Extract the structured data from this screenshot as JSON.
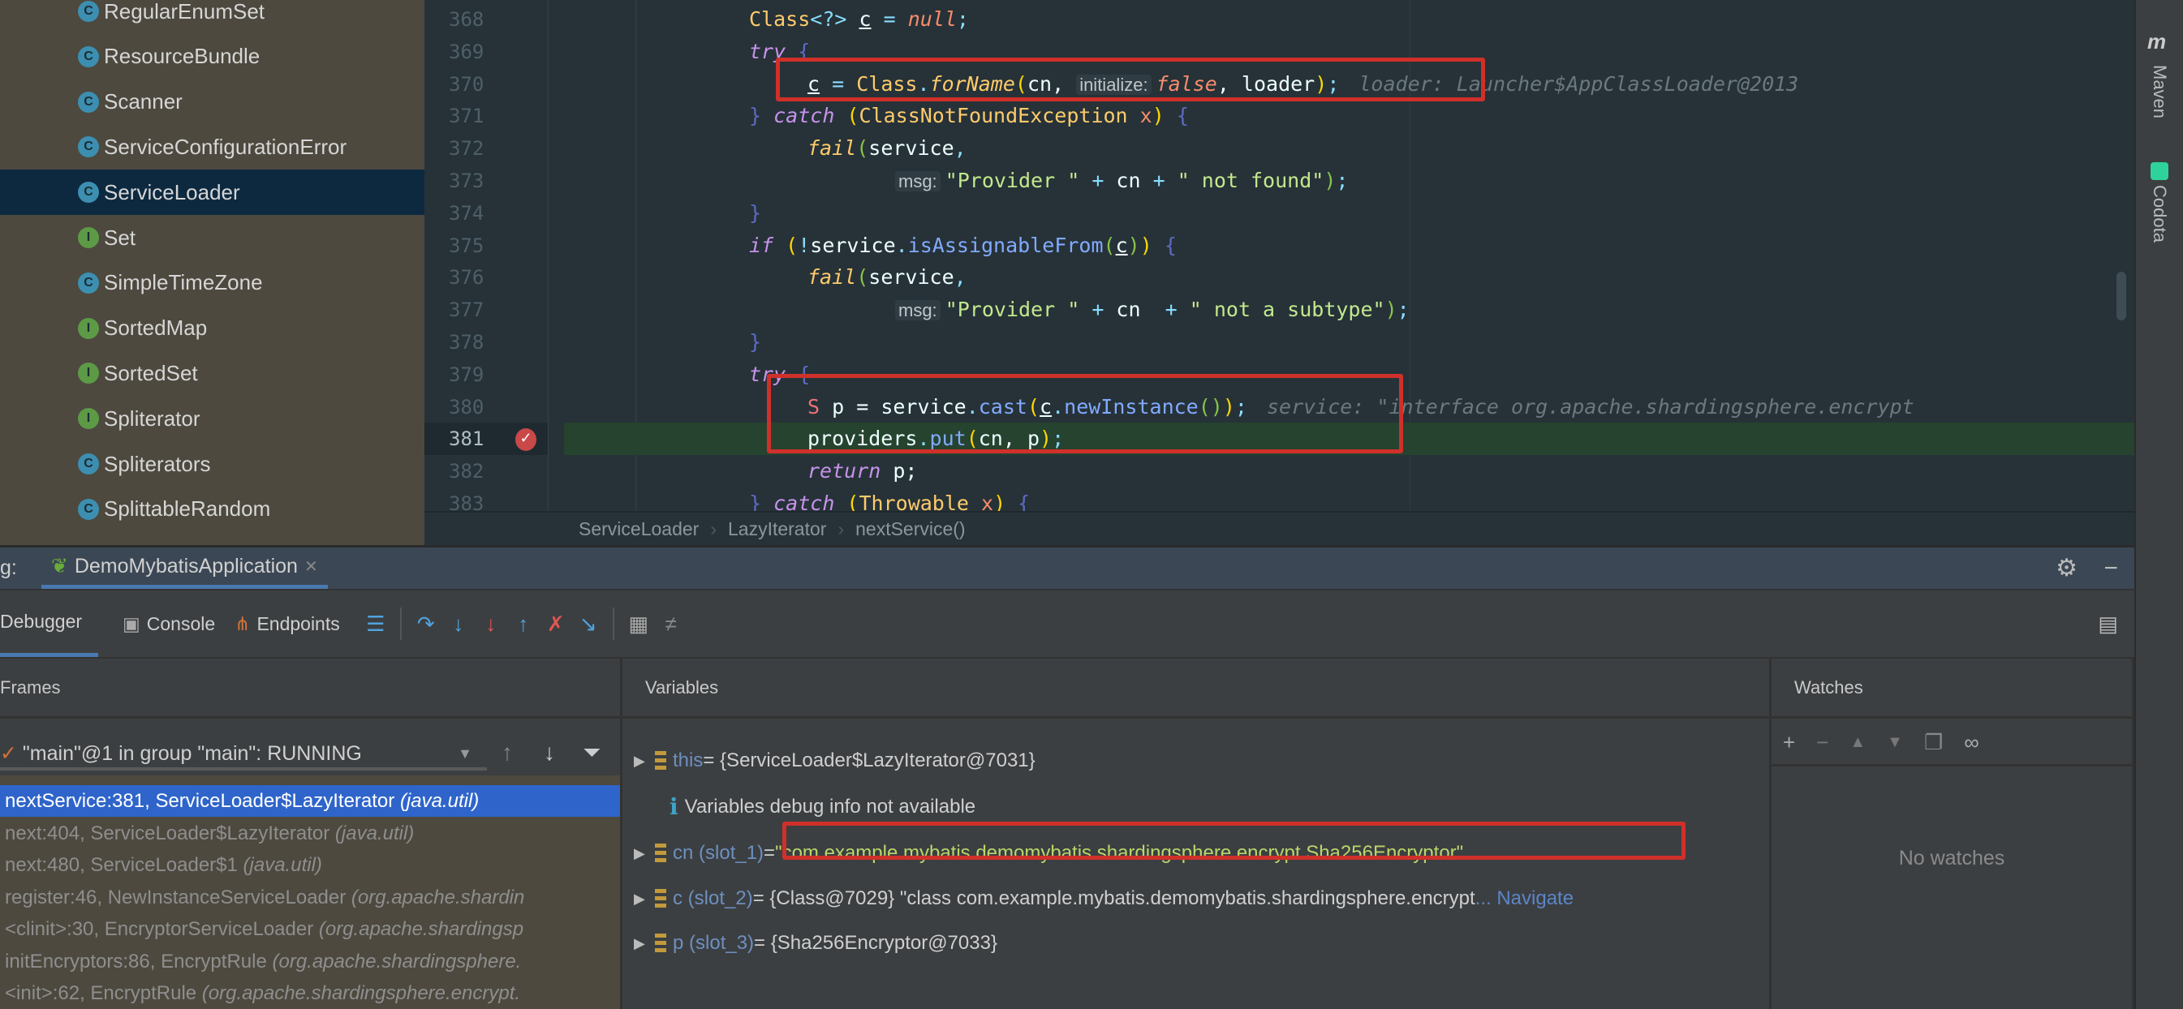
{
  "project_tree": {
    "selected": "ServiceLoader",
    "items": [
      {
        "label": "RegularEnumSet",
        "kind": "class"
      },
      {
        "label": "ResourceBundle",
        "kind": "class"
      },
      {
        "label": "Scanner",
        "kind": "class"
      },
      {
        "label": "ServiceConfigurationError",
        "kind": "class"
      },
      {
        "label": "ServiceLoader",
        "kind": "class"
      },
      {
        "label": "Set",
        "kind": "interface"
      },
      {
        "label": "SimpleTimeZone",
        "kind": "class"
      },
      {
        "label": "SortedMap",
        "kind": "interface"
      },
      {
        "label": "SortedSet",
        "kind": "interface"
      },
      {
        "label": "Spliterator",
        "kind": "interface"
      },
      {
        "label": "Spliterators",
        "kind": "class"
      },
      {
        "label": "SplittableRandom",
        "kind": "class"
      }
    ]
  },
  "editor": {
    "current_line": 381,
    "lines": [
      {
        "n": "368",
        "indent": 0,
        "tokens": [
          [
            "Class",
            "cls"
          ],
          [
            "<?>",
            "p"
          ],
          [
            " ",
            "v"
          ],
          [
            "c",
            "u"
          ],
          [
            " = ",
            "p"
          ],
          [
            "null",
            "lit"
          ],
          [
            ";",
            "p"
          ]
        ]
      },
      {
        "n": "369",
        "indent": 0,
        "tokens": [
          [
            "try",
            "kw"
          ],
          [
            " {",
            "b"
          ]
        ]
      },
      {
        "n": "370",
        "indent": 1,
        "tokens": [
          [
            "c",
            "u"
          ],
          [
            " = ",
            "p"
          ],
          [
            "Class",
            "cls"
          ],
          [
            ".",
            "p"
          ],
          [
            "forName",
            "fn"
          ],
          [
            "(",
            "y"
          ],
          [
            "cn, ",
            "v"
          ],
          [
            "initialize:",
            "hint"
          ],
          [
            "false",
            "lit"
          ],
          [
            ", loader",
            "v"
          ],
          [
            ")",
            "y"
          ],
          [
            ";",
            "p"
          ],
          [
            "loader: Launcher$AppClassLoader@2013",
            "dbg"
          ]
        ]
      },
      {
        "n": "371",
        "indent": 0,
        "tokens": [
          [
            "} ",
            "b"
          ],
          [
            "catch",
            "kw"
          ],
          [
            " (",
            "y"
          ],
          [
            "ClassNotFoundException",
            "cls"
          ],
          [
            " x",
            "x"
          ],
          [
            ")",
            "y"
          ],
          [
            " {",
            "b"
          ]
        ]
      },
      {
        "n": "372",
        "indent": 1,
        "tokens": [
          [
            "fail",
            "fn"
          ],
          [
            "(",
            "g"
          ],
          [
            "service",
            "v"
          ],
          [
            ",",
            "p"
          ]
        ]
      },
      {
        "n": "373",
        "indent": 2.5,
        "tokens": [
          [
            "msg:",
            "hint"
          ],
          [
            "\"Provider \"",
            "str"
          ],
          [
            " + ",
            "p"
          ],
          [
            "cn",
            "v"
          ],
          [
            " + ",
            "p"
          ],
          [
            "\" not found\"",
            "str"
          ],
          [
            ")",
            "g"
          ],
          [
            ";",
            "p"
          ]
        ]
      },
      {
        "n": "374",
        "indent": 0,
        "tokens": [
          [
            "}",
            "b"
          ]
        ]
      },
      {
        "n": "375",
        "indent": 0,
        "tokens": [
          [
            "if",
            "kw"
          ],
          [
            " (",
            "y"
          ],
          [
            "!",
            "p"
          ],
          [
            "service",
            "v"
          ],
          [
            ".",
            "p"
          ],
          [
            "isAssignableFrom",
            "m"
          ],
          [
            "(",
            "g"
          ],
          [
            "c",
            "u"
          ],
          [
            ")",
            "g"
          ],
          [
            ")",
            "y"
          ],
          [
            " {",
            "b"
          ]
        ]
      },
      {
        "n": "376",
        "indent": 1,
        "tokens": [
          [
            "fail",
            "fn"
          ],
          [
            "(",
            "g"
          ],
          [
            "service",
            "v"
          ],
          [
            ",",
            "p"
          ]
        ]
      },
      {
        "n": "377",
        "indent": 2.5,
        "tokens": [
          [
            "msg:",
            "hint"
          ],
          [
            "\"Provider \"",
            "str"
          ],
          [
            " + ",
            "p"
          ],
          [
            "cn",
            "v"
          ],
          [
            "  + ",
            "p"
          ],
          [
            "\" not a subtype\"",
            "str"
          ],
          [
            ")",
            "g"
          ],
          [
            ";",
            "p"
          ]
        ]
      },
      {
        "n": "378",
        "indent": 0,
        "tokens": [
          [
            "}",
            "b"
          ]
        ]
      },
      {
        "n": "379",
        "indent": 0,
        "tokens": [
          [
            "try",
            "kw"
          ],
          [
            " {",
            "b"
          ]
        ]
      },
      {
        "n": "380",
        "indent": 1,
        "tokens": [
          [
            "S",
            "tp"
          ],
          [
            " p = ",
            "v"
          ],
          [
            "service",
            "v"
          ],
          [
            ".",
            "p"
          ],
          [
            "cast",
            "m"
          ],
          [
            "(",
            "y"
          ],
          [
            "c",
            "u"
          ],
          [
            ".",
            "p"
          ],
          [
            "newInstance",
            "m"
          ],
          [
            "()",
            "g"
          ],
          [
            ")",
            "y"
          ],
          [
            ";",
            "p"
          ],
          [
            "service: \"interface org.apache.shardingsphere.encrypt",
            "dbg"
          ]
        ]
      },
      {
        "n": "381",
        "indent": 1,
        "tokens": [
          [
            "providers",
            "v"
          ],
          [
            ".",
            "p"
          ],
          [
            "put",
            "m"
          ],
          [
            "(",
            "y"
          ],
          [
            "cn, p",
            "v"
          ],
          [
            ")",
            "y"
          ],
          [
            ";",
            "p"
          ]
        ]
      },
      {
        "n": "382",
        "indent": 1,
        "tokens": [
          [
            "return",
            "kw"
          ],
          [
            " p;",
            "v"
          ]
        ]
      },
      {
        "n": "383",
        "indent": 0,
        "tokens": [
          [
            "} ",
            "b"
          ],
          [
            "catch",
            "kw"
          ],
          [
            " (",
            "y"
          ],
          [
            "Throwable",
            "cls"
          ],
          [
            " x",
            "x"
          ],
          [
            ")",
            "y"
          ],
          [
            " {",
            "b"
          ]
        ]
      }
    ]
  },
  "breadcrumbs": [
    "ServiceLoader",
    "LazyIterator",
    "nextService()"
  ],
  "right_stripe": {
    "maven": "Maven",
    "codota": "Codota"
  },
  "debug": {
    "title_prefix": "g:",
    "run_tab": "DemoMybatisApplication",
    "tabs": {
      "debugger": "Debugger",
      "console": "Console",
      "endpoints": "Endpoints"
    },
    "frames": {
      "header": "Frames",
      "thread": "\"main\"@1 in group \"main\": RUNNING",
      "items": [
        {
          "method": "nextService:381, ServiceLoader$LazyIterator ",
          "pkg": "(java.util)"
        },
        {
          "method": "next:404, ServiceLoader$LazyIterator ",
          "pkg": "(java.util)"
        },
        {
          "method": "next:480, ServiceLoader$1 ",
          "pkg": "(java.util)"
        },
        {
          "method": "register:46, NewInstanceServiceLoader ",
          "pkg": "(org.apache.shardin"
        },
        {
          "method": "<clinit>:30, EncryptorServiceLoader ",
          "pkg": "(org.apache.shardingsp"
        },
        {
          "method": "initEncryptors:86, EncryptRule ",
          "pkg": "(org.apache.shardingsphere."
        },
        {
          "method": "<init>:62, EncryptRule ",
          "pkg": "(org.apache.shardingsphere.encrypt."
        }
      ]
    },
    "variables": {
      "header": "Variables",
      "info": "Variables debug info not available",
      "items": [
        {
          "name": "this",
          "value": " = {ServiceLoader$LazyIterator@7031}"
        },
        {
          "name": "cn (slot_1)",
          "value": " = ",
          "str": "\"com.example.mybatis.demomybatis.shardingsphere.encrypt.Sha256Encryptor\""
        },
        {
          "name": "c (slot_2)",
          "value": " = {Class@7029} \"class com.example.mybatis.demomybatis.shardingsphere.encrypt",
          "link": "... Navigate"
        },
        {
          "name": "p (slot_3)",
          "value": " = {Sha256Encryptor@7033}"
        }
      ]
    },
    "watches": {
      "header": "Watches",
      "empty": "No watches"
    }
  },
  "colors": {
    "highlight_box": "#d0302a",
    "selected_frame": "#2f65ca",
    "current_line": "#25432f",
    "editor_bg": "#263238"
  }
}
